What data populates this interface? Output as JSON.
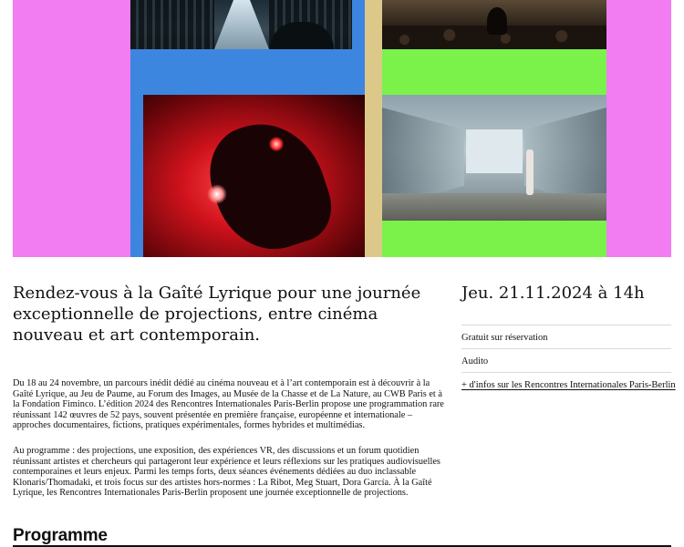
{
  "hero": {
    "colors": {
      "pink": "#f27cf2",
      "blue": "#3c86e0",
      "beige": "#dcc98a",
      "green": "#7bf24a"
    },
    "tiles": [
      "data-center-image",
      "auditorium-image",
      "red-microscope-image",
      "gallery-vitrines-image"
    ]
  },
  "event": {
    "intro": "Rendez-vous à la Gaîté Lyrique pour une journée exceptionnelle de projections, entre cinéma nouveau et art contemporain.",
    "paragraph1": "Du 18 au 24 novembre, un parcours inédit dédié au cinéma nouveau et à l’art contemporain est à découvrir à la Gaîté Lyrique, au Jeu de Paume, au Forum des Images, au Musée de la Chasse et de La Nature, au CWB Paris et à la Fondation Fiminco. L’édition 2024 des Rencontres Internationales Paris-Berlin propose une programmation rare réunissant 142 œuvres de 52 pays, souvent présentée en première française, européenne et internationale – approches documentaires, fictions, pratiques expérimentales, formes hybrides et multimédias.",
    "paragraph2": "Au programme : des projections, une exposition, des expériences VR, des discussions et un forum quotidien réunissant artistes et chercheurs qui partageront leur expérience et leurs réflexions sur les pratiques audiovisuelles contemporaines et leurs enjeux. Parmi les temps forts, deux séances événements dédiées au duo inclassable Klonaris/Thomadaki, et trois focus sur des artistes hors-normes : La Ribot, Meg Stuart, Dora García. À la Gaîté Lyrique, les Rencontres Internationales Paris-Berlin proposent une journée exceptionnelle de projections."
  },
  "sidebar": {
    "date": "Jeu. 21.11.2024 à 14h",
    "price": "Gratuit sur réservation",
    "venue": "Audito",
    "more_link": "+ d'infos sur les Rencontres Internationales Paris-Berlin"
  },
  "section": {
    "programme_title": "Programme"
  }
}
